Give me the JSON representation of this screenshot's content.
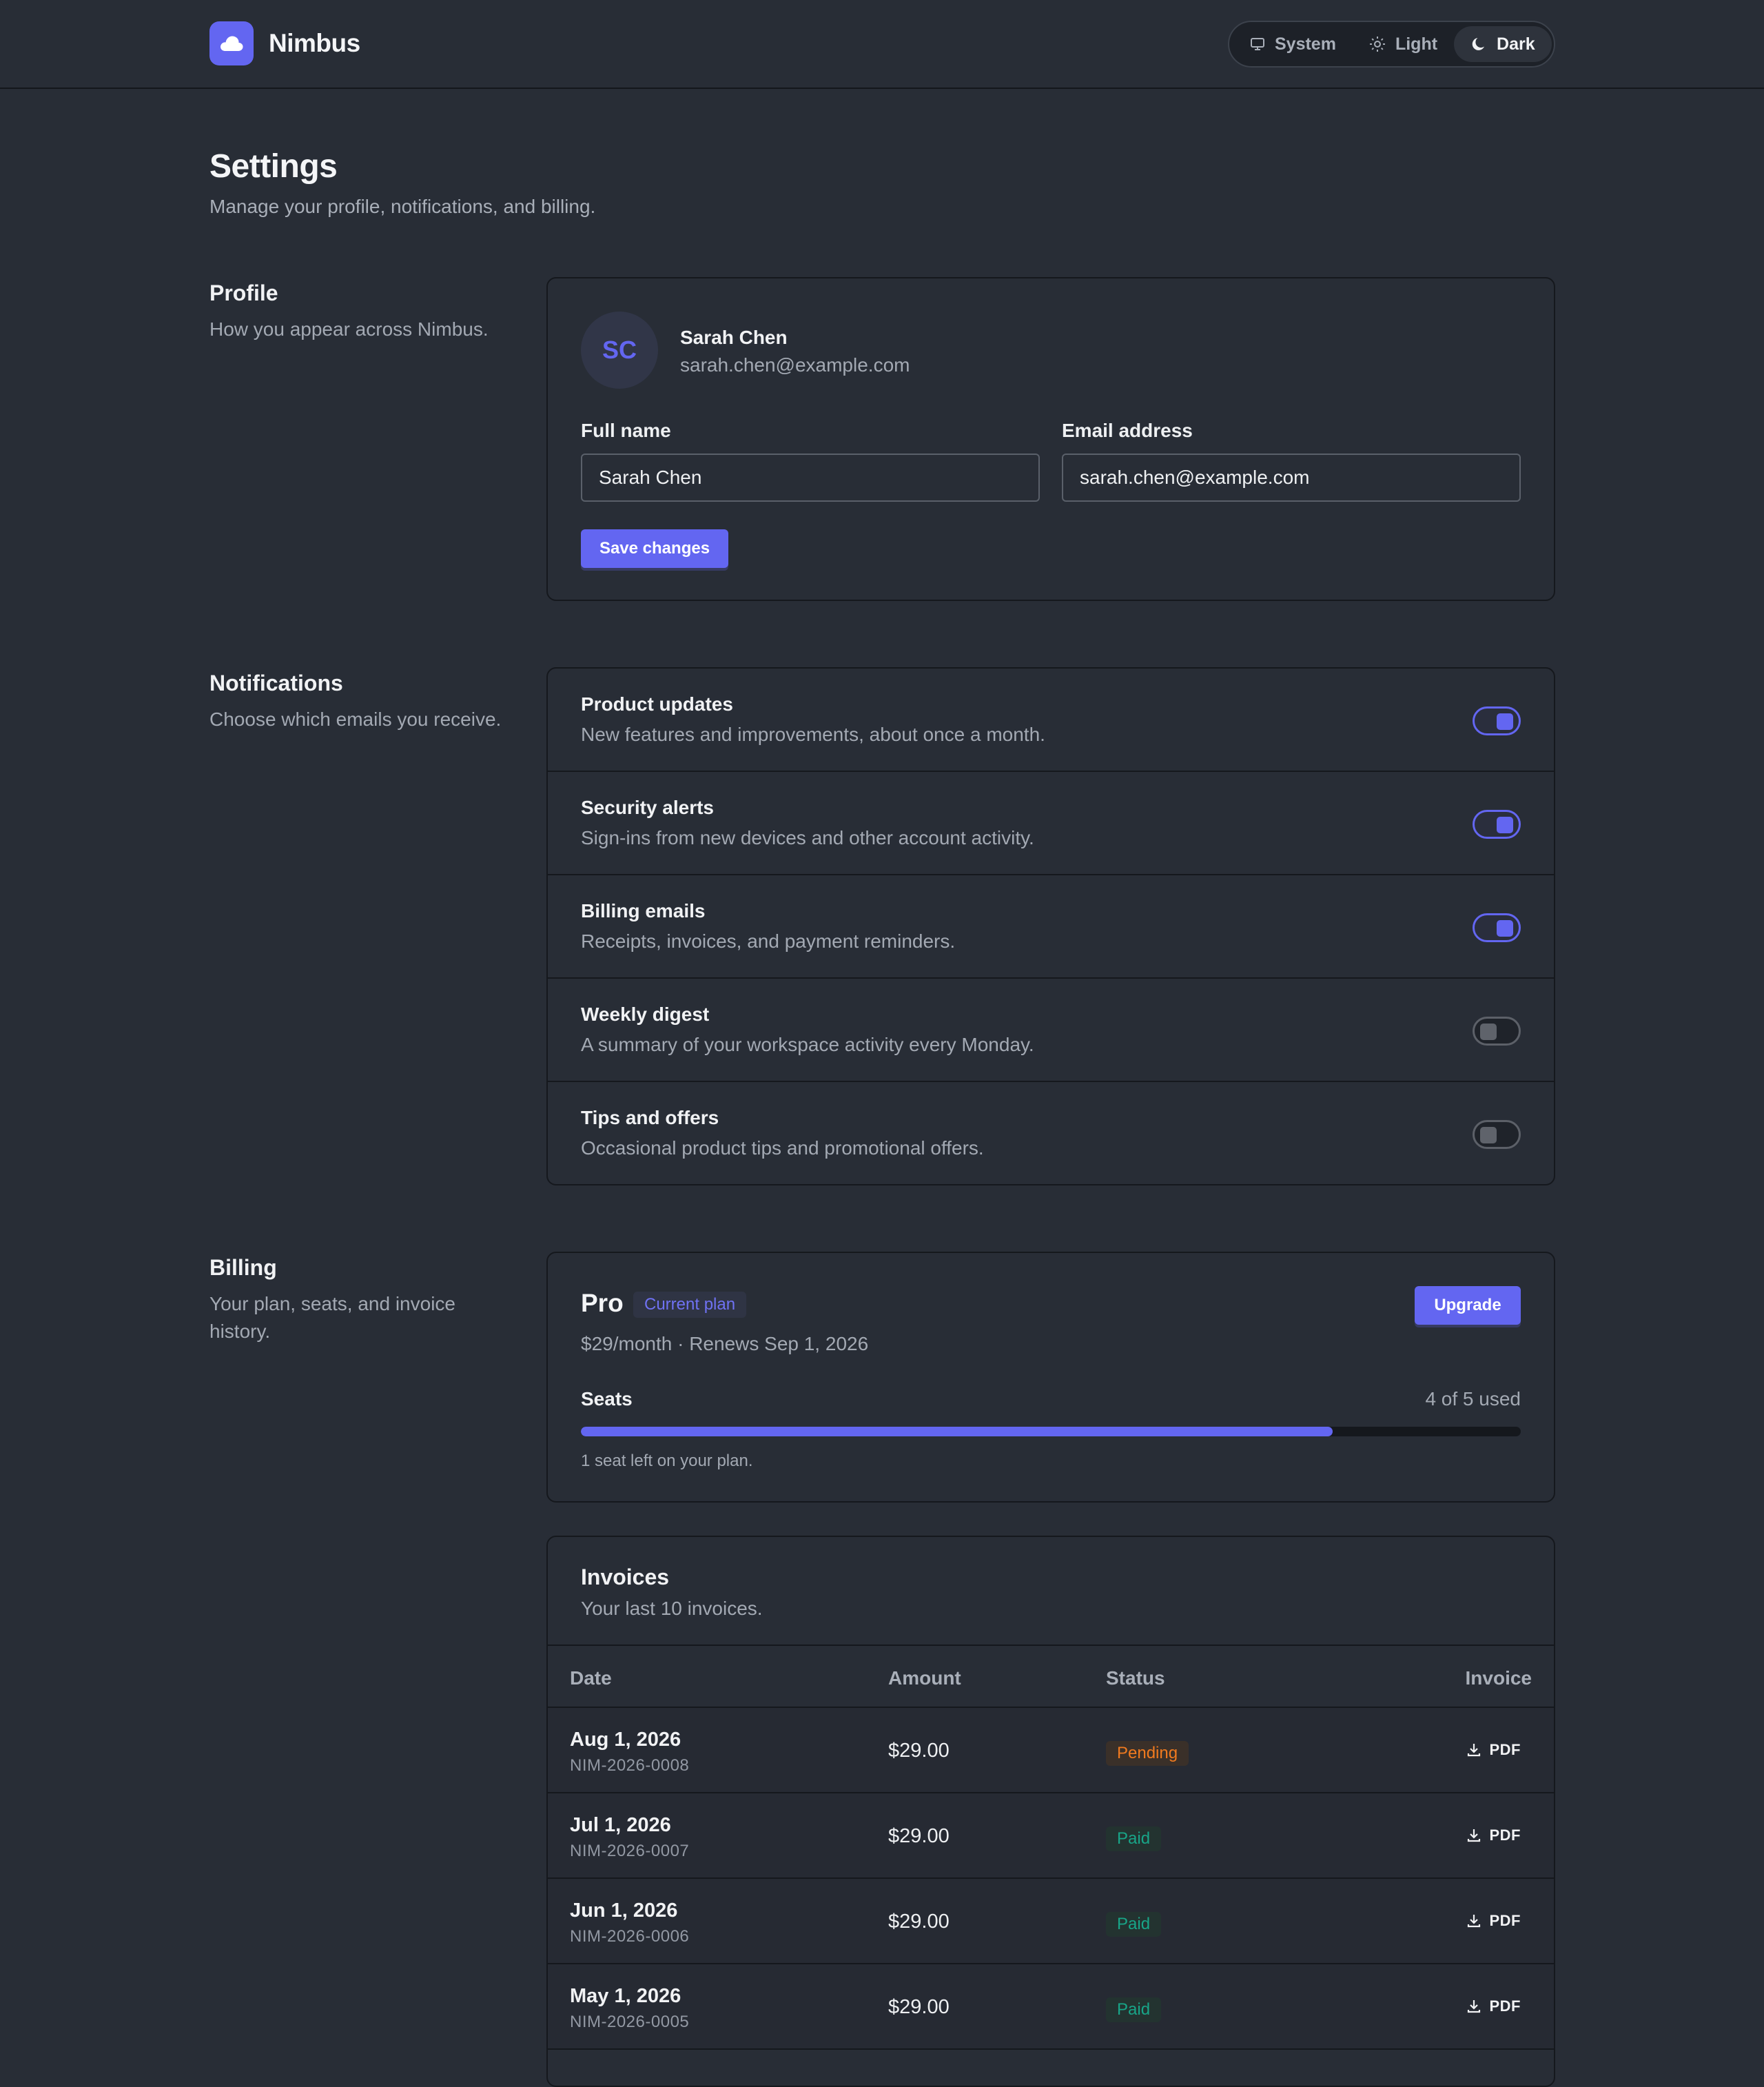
{
  "app": {
    "name": "Nimbus",
    "accent": "#6366f1"
  },
  "theme": {
    "options": [
      "System",
      "Light",
      "Dark"
    ],
    "selected": "Dark"
  },
  "page": {
    "title": "Settings",
    "subtitle": "Manage your profile, notifications, and billing."
  },
  "profile": {
    "section_title": "Profile",
    "section_desc": "How you appear across Nimbus.",
    "initials": "SC",
    "name": "Sarah Chen",
    "email": "sarah.chen@example.com",
    "full_name_label": "Full name",
    "full_name_value": "Sarah Chen",
    "email_label": "Email address",
    "email_value": "sarah.chen@example.com",
    "save_label": "Save changes"
  },
  "notifications": {
    "section_title": "Notifications",
    "section_desc": "Choose which emails you receive.",
    "items": [
      {
        "title": "Product updates",
        "desc": "New features and improvements, about once a month.",
        "enabled": true
      },
      {
        "title": "Security alerts",
        "desc": "Sign-ins from new devices and other account activity.",
        "enabled": true
      },
      {
        "title": "Billing emails",
        "desc": "Receipts, invoices, and payment reminders.",
        "enabled": true
      },
      {
        "title": "Weekly digest",
        "desc": "A summary of your workspace activity every Monday.",
        "enabled": false
      },
      {
        "title": "Tips and offers",
        "desc": "Occasional product tips and promotional offers.",
        "enabled": false
      }
    ]
  },
  "billing": {
    "section_title": "Billing",
    "section_desc": "Your plan, seats, and invoice history.",
    "plan_name": "Pro",
    "plan_badge": "Current plan",
    "price_line": "$29/month · Renews Sep 1, 2026",
    "upgrade_label": "Upgrade",
    "seats_label": "Seats",
    "seats_used_text": "4 of 5 used",
    "seats_used": 4,
    "seats_total": 5,
    "seats_note": "1 seat left on your plan."
  },
  "invoices": {
    "title": "Invoices",
    "subtitle": "Your last 10 invoices.",
    "columns": [
      "Date",
      "Amount",
      "Status",
      "Invoice"
    ],
    "rows": [
      {
        "date": "Aug 1, 2026",
        "number": "NIM-2026-0008",
        "amount": "$29.00",
        "status": "Pending",
        "link": "PDF"
      },
      {
        "date": "Jul 1, 2026",
        "number": "NIM-2026-0007",
        "amount": "$29.00",
        "status": "Paid",
        "link": "PDF"
      },
      {
        "date": "Jun 1, 2026",
        "number": "NIM-2026-0006",
        "amount": "$29.00",
        "status": "Paid",
        "link": "PDF"
      },
      {
        "date": "May 1, 2026",
        "number": "NIM-2026-0005",
        "amount": "$29.00",
        "status": "Paid",
        "link": "PDF"
      }
    ]
  }
}
